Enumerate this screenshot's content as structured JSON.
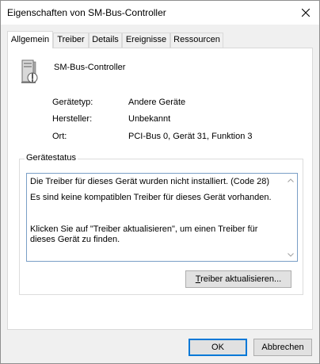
{
  "window": {
    "title": "Eigenschaften von SM-Bus-Controller"
  },
  "tabs": [
    {
      "label": "Allgemein",
      "active": true
    },
    {
      "label": "Treiber",
      "active": false
    },
    {
      "label": "Details",
      "active": false
    },
    {
      "label": "Ereignisse",
      "active": false
    },
    {
      "label": "Ressourcen",
      "active": false
    }
  ],
  "device": {
    "name": "SM-Bus-Controller",
    "icon": "device-manager-unknown-device-icon"
  },
  "properties": [
    {
      "label": "Gerätetyp:",
      "value": "Andere Geräte"
    },
    {
      "label": "Hersteller:",
      "value": "Unbekannt"
    },
    {
      "label": "Ort:",
      "value": "PCI-Bus 0, Gerät 31, Funktion 3"
    }
  ],
  "status_group": {
    "title": "Gerätestatus",
    "lines": [
      "Die Treiber für dieses Gerät wurden nicht installiert. (Code 28)",
      "Es sind keine kompatiblen Treiber für dieses Gerät vorhanden.",
      "Klicken Sie auf \"Treiber aktualisieren\", um einen Treiber für dieses Gerät zu finden."
    ]
  },
  "buttons": {
    "update_driver_accel": "T",
    "update_driver_rest": "reiber aktualisieren...",
    "ok": "OK",
    "cancel": "Abbrechen"
  },
  "colors": {
    "accent": "#0078d7",
    "dialog_bg": "#f0f0f0",
    "statusbox_border": "#7a9fc6"
  }
}
